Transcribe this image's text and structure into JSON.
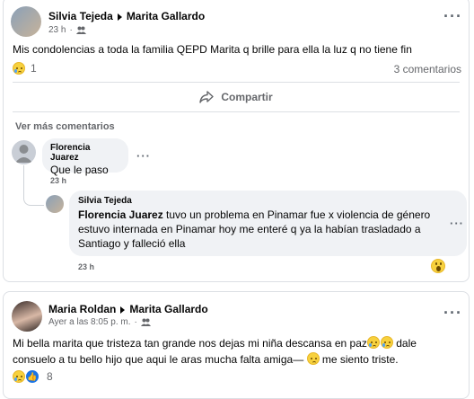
{
  "post1": {
    "author": "Silvia Tejeda",
    "target": "Marita Gallardo",
    "time": "23 h",
    "audience_icon": "friends-icon",
    "text": "Mis condolencias a toda la familia QEPD Marita q brille para ella la luz q no tiene fin",
    "reaction_count": "1",
    "comments_count": "3 comentarios",
    "share_label": "Compartir",
    "more_comments_label": "Ver más comentarios",
    "comment1": {
      "author": "Florencia Juarez",
      "text": "Que le paso",
      "time": "23 h"
    },
    "reply1": {
      "author": "Silvia Tejeda",
      "mention": "Florencia Juarez",
      "text": " tuvo un problema en Pinamar fue x violencia de género estuvo internada en Pinamar hoy me enteré q ya la habían trasladado a Santiago y falleció ella",
      "time": "23 h"
    }
  },
  "post2": {
    "author": "Maria Roldan",
    "target": "Marita Gallardo",
    "time": "Ayer a las 8:05 p. m.",
    "audience_icon": "friends-icon",
    "text_part1": "Mi bella marita que tristeza tan grande nos dejas mi niña descansa en paz",
    "text_part2": " dale consuelo a tu bello hijo que aqui le aras mucha falta amiga— ",
    "text_part3": " me siento triste.",
    "reaction_count": "8"
  },
  "colors": {
    "primary_text": "#050505",
    "secondary_text": "#65676b",
    "bubble_bg": "#f0f2f5",
    "like_blue": "#1b74e4"
  }
}
